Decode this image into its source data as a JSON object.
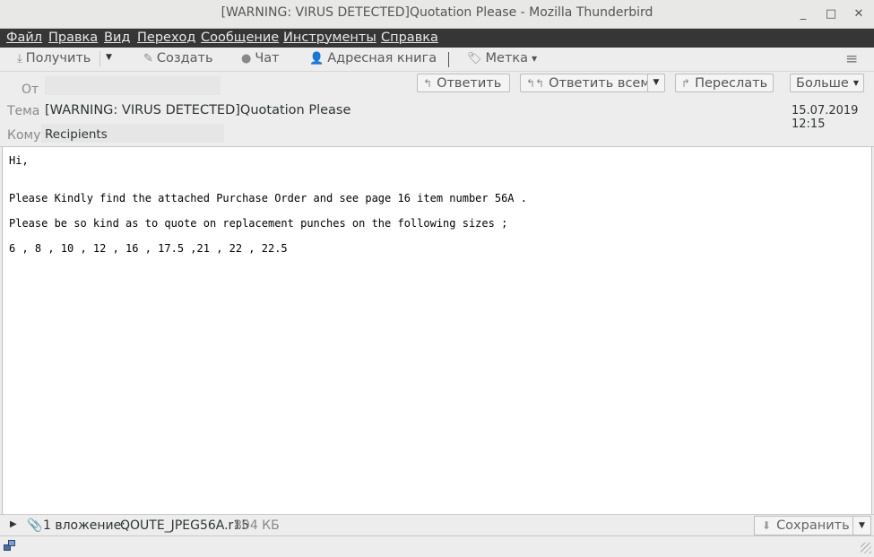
{
  "window": {
    "title": "[WARNING: VIRUS DETECTED]Quotation Please - Mozilla Thunderbird",
    "minimize": "_",
    "maximize": "□",
    "close": "✕"
  },
  "menu": [
    "Файл",
    "Правка",
    "Вид",
    "Переход",
    "Сообщение",
    "Инструменты",
    "Справка"
  ],
  "toolbar": {
    "get": "Получить",
    "write": "Создать",
    "chat": "Чат",
    "address_book": "Адресная книга",
    "tag": "Метка"
  },
  "header": {
    "from_label": "От",
    "subject_label": "Тема",
    "subject": "[WARNING: VIRUS DETECTED]Quotation Please",
    "to_label": "Кому",
    "to": "Recipients",
    "date": "15.07.2019 12:15",
    "reply": "Ответить",
    "reply_all": "Ответить всем",
    "forward": "Переслать",
    "more": "Больше"
  },
  "body_lines": [
    "Hi,",
    "Please Kindly find the attached Purchase Order and see page 16 item number 56A .",
    "Please be so kind as to quote on replacement punches on the following sizes ;",
    "6 , 8 , 10 , 12 , 16 , 17.5 ,21 , 22 , 22.5"
  ],
  "attachment": {
    "count_label": "1 вложение:",
    "filename": "QOUTE_JPEG56A.r15",
    "size": "804 КБ",
    "save": "Сохранить"
  },
  "icons": {
    "get": "download-arrow-icon",
    "write": "pencil-icon",
    "chat": "chat-bubbles-icon",
    "address_book": "person-icon",
    "tag": "tag-icon",
    "menu": "hamburger-icon"
  }
}
